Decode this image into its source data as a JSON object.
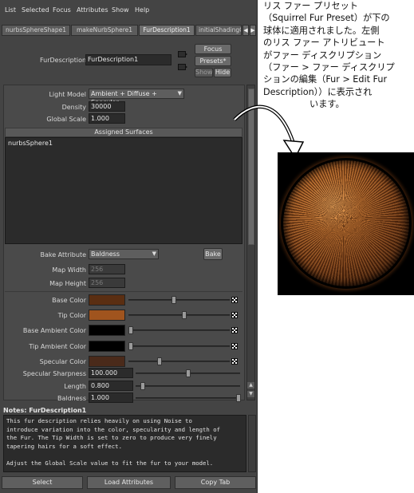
{
  "menu": [
    "List",
    "Selected",
    "Focus",
    "Attributes",
    "Show",
    "Help"
  ],
  "tabs": [
    {
      "label": "nurbsSphereShape1",
      "active": false
    },
    {
      "label": "makeNurbSphere1",
      "active": false
    },
    {
      "label": "FurDescription1",
      "active": true
    },
    {
      "label": "initialShadingG",
      "active": false
    }
  ],
  "node": {
    "label": "FurDescription:",
    "value": "FurDescription1",
    "focus_label": "Focus",
    "presets_label": "Presets*",
    "show_label": "Show",
    "hide_label": "Hide"
  },
  "attributes": {
    "light_model_label": "Light Model",
    "light_model_value": "Ambient + Diffuse + Specular",
    "density_label": "Density",
    "density_value": "30000",
    "global_scale_label": "Global Scale",
    "global_scale_value": "1.000",
    "assigned_surfaces_title": "Assigned Surfaces",
    "assigned_surfaces": [
      "nurbsSphere1"
    ],
    "bake_attribute_label": "Bake Attribute",
    "bake_attribute_value": "Baldness",
    "bake_button": "Bake",
    "map_width_label": "Map Width",
    "map_width_value": "256",
    "map_height_label": "Map Height",
    "map_height_value": "256"
  },
  "colors": [
    {
      "label": "Base Color",
      "swatch": "#5a2e12",
      "slider": 0.45
    },
    {
      "label": "Tip Color",
      "swatch": "#a0541e",
      "slider": 0.55
    },
    {
      "label": "Base Ambient Color",
      "swatch": "#000000",
      "slider": 0.0
    },
    {
      "label": "Tip Ambient Color",
      "swatch": "#000000",
      "slider": 0.0
    },
    {
      "label": "Specular Color",
      "swatch": "#4a2a1a",
      "slider": 0.3
    }
  ],
  "numeric_attrs": [
    {
      "label": "Specular Sharpness",
      "value": "100.000",
      "slider": 0.5
    },
    {
      "label": "Length",
      "value": "0.800",
      "slider": 0.05
    },
    {
      "label": "Baldness",
      "value": "1.000",
      "slider": 1.0
    }
  ],
  "notes": {
    "title": "Notes: FurDescription1",
    "text": "This fur description relies heavily on using Noise to\nintroduce variation into the color, specularity and length of\nthe Fur. The Tip Width is set to zero to produce very finely\ntapering hairs for a soft effect.\n\nAdjust the Global Scale value to fit the fur to your model."
  },
  "bottom_buttons": {
    "select": "Select",
    "load": "Load Attributes",
    "copy": "Copy Tab"
  },
  "annotation": {
    "lines": [
      "リス ファー プリセット",
      "（Squirrel Fur Preset）が下の",
      "球体に適用されました。左側",
      "のリス ファー アトリビュート",
      "がファー ディスクリプション",
      "（ファー > ファー ディスクリプ",
      "ションの編集（Fur > Edit Fur",
      "Description））に表示され"
    ],
    "last_line": "います。"
  }
}
